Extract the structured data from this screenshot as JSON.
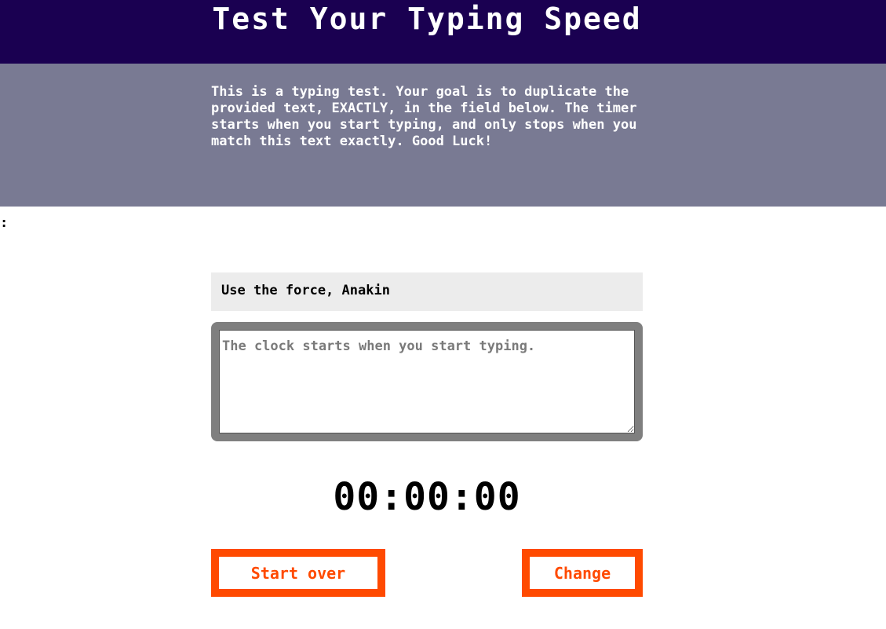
{
  "header": {
    "title": "Test Your Typing Speed"
  },
  "intro": {
    "text": "This is a typing test. Your goal is to duplicate the provided text, EXACTLY, in the field below. The timer starts when you start typing, and only stops when you match this text exactly. Good Luck!"
  },
  "stray_text": ":",
  "test": {
    "origin_text": "Use the force, Anakin",
    "entry_value": "",
    "entry_placeholder": "The clock starts when you start typing."
  },
  "timer": {
    "display": "00:00:00"
  },
  "buttons": {
    "reset_label": "Start over",
    "change_label": "Change"
  },
  "colors": {
    "header_bg": "#1a0051",
    "intro_bg": "#797a93",
    "prompt_bg": "#ececec",
    "entry_border": "#7f7f7f",
    "button_accent": "#ff4a00"
  }
}
